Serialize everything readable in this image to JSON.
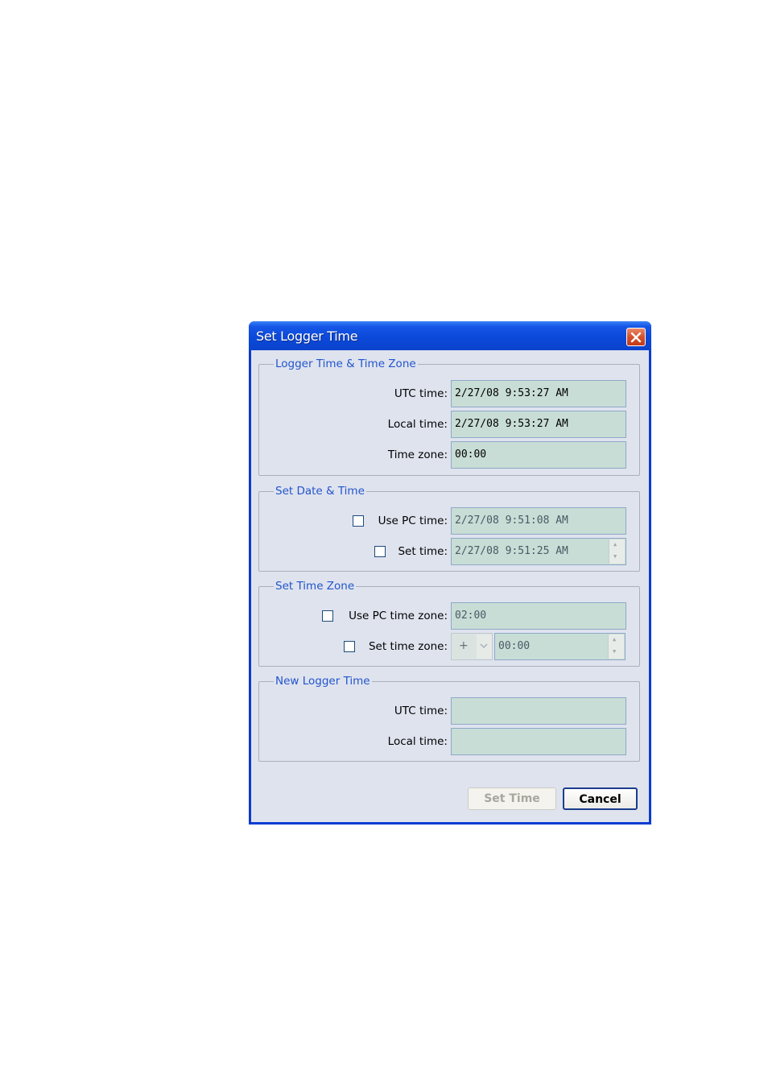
{
  "window": {
    "title": "Set Logger Time"
  },
  "logger_time_group": {
    "legend": "Logger Time & Time Zone",
    "utc_label": "UTC time:",
    "utc_value": "2/27/08 9:53:27 AM",
    "local_label": "Local time:",
    "local_value": "2/27/08 9:53:27 AM",
    "tz_label": "Time zone:",
    "tz_value": "00:00"
  },
  "set_date_group": {
    "legend": "Set Date & Time",
    "use_pc_label": "Use PC time:",
    "use_pc_value": "2/27/08 9:51:08 AM",
    "use_pc_checked": false,
    "set_time_label": "Set time:",
    "set_time_value": "2/27/08 9:51:25 AM",
    "set_time_checked": false
  },
  "set_tz_group": {
    "legend": "Set Time Zone",
    "use_pc_tz_label": "Use PC time zone:",
    "use_pc_tz_value": "02:00",
    "use_pc_tz_checked": false,
    "set_tz_label": "Set time zone:",
    "set_tz_sign": "+",
    "set_tz_value": "00:00",
    "set_tz_checked": false
  },
  "new_time_group": {
    "legend": "New Logger Time",
    "utc_label": "UTC time:",
    "utc_value": "",
    "local_label": "Local time:",
    "local_value": ""
  },
  "buttons": {
    "set_time": "Set Time",
    "cancel": "Cancel"
  },
  "icons": {
    "close": "close-icon",
    "spin_up": "spin-up-icon",
    "spin_down": "spin-down-icon",
    "dropdown": "chevron-down-icon"
  },
  "colors": {
    "titlebar": "#0b49da",
    "client_bg": "#dfe3ee",
    "legend_text": "#2255cc",
    "field_bg": "#c8ddd5",
    "close_button": "#d8502c"
  }
}
